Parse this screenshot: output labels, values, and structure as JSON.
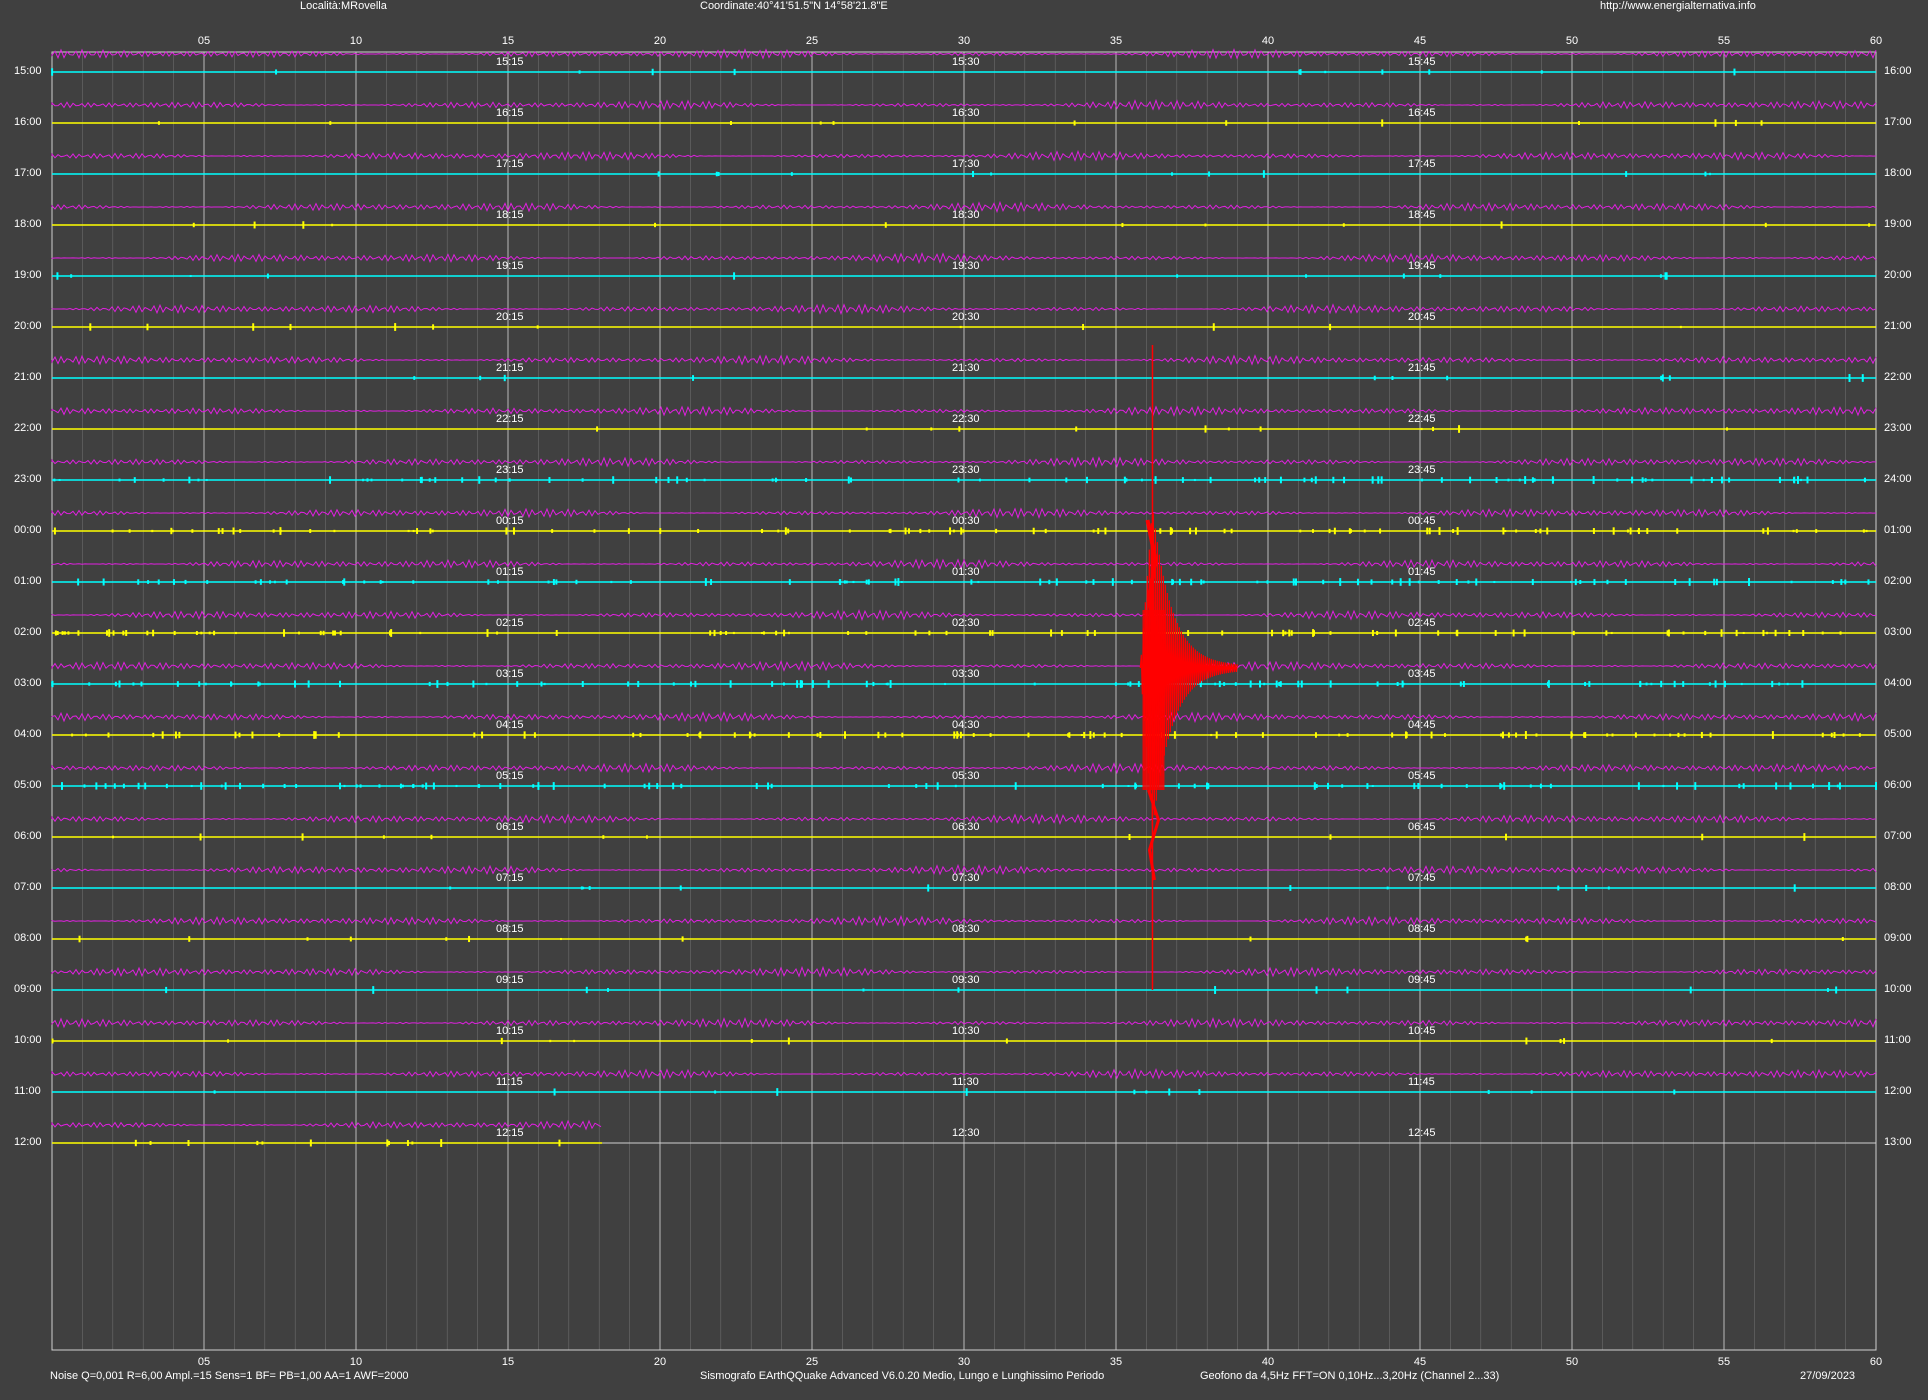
{
  "header": {
    "location": "Località:MRovella",
    "coordinates": "Coordinate:40°41'51.5\"N 14°58'21.8\"E",
    "url": "http://www.energialternativa.info"
  },
  "footer": {
    "settings": "Noise Q=0,001 R=6,00 Ampl.=15 Sens=1 BF= PB=1,00 AA=1 AWF=2000",
    "software": "Sismografo  EArthQQuake Advanced V6.0.20  Medio, Lungo e Lunghissimo Periodo",
    "sensor": "Geofono da 4,5Hz FFT=ON 0,10Hz...3,20Hz      (Channel 2...33)",
    "date": "27/09/2023"
  },
  "colors": {
    "background": "#404040",
    "grid_major": "#d0d0d0",
    "grid_minor": "#8a8a8a",
    "trace_yellow": "#ffff00",
    "trace_cyan": "#00ffff",
    "trace_magenta": "#e020e0",
    "event_red": "#ff0000",
    "text": "#ffffff"
  },
  "chart_data": {
    "type": "line",
    "minute_ticks": [
      "05",
      "10",
      "15",
      "20",
      "25",
      "30",
      "35",
      "40",
      "45",
      "50",
      "55",
      "60"
    ],
    "xlim": [
      0,
      60
    ],
    "row_labels_left": [
      "15:00",
      "16:00",
      "17:00",
      "18:00",
      "19:00",
      "20:00",
      "21:00",
      "22:00",
      "23:00",
      "00:00",
      "01:00",
      "02:00",
      "03:00",
      "04:00",
      "05:00",
      "06:00",
      "07:00",
      "08:00",
      "09:00",
      "10:00",
      "11:00",
      "12:00"
    ],
    "row_labels_right": [
      "16:00",
      "17:00",
      "18:00",
      "19:00",
      "20:00",
      "21:00",
      "22:00",
      "23:00",
      "24:00",
      "01:00",
      "02:00",
      "03:00",
      "04:00",
      "05:00",
      "06:00",
      "07:00",
      "08:00",
      "09:00",
      "10:00",
      "11:00",
      "12:00",
      "13:00"
    ],
    "quarter_labels": [
      [
        "15:15",
        "15:30",
        "15:45"
      ],
      [
        "16:15",
        "16:30",
        "16:45"
      ],
      [
        "17:15",
        "17:30",
        "17:45"
      ],
      [
        "18:15",
        "18:30",
        "18:45"
      ],
      [
        "19:15",
        "19:30",
        "19:45"
      ],
      [
        "20:15",
        "20:30",
        "20:45"
      ],
      [
        "21:15",
        "21:30",
        "21:45"
      ],
      [
        "22:15",
        "22:30",
        "22:45"
      ],
      [
        "23:15",
        "23:30",
        "23:45"
      ],
      [
        "00:15",
        "00:30",
        "00:45"
      ],
      [
        "01:15",
        "01:30",
        "01:45"
      ],
      [
        "02:15",
        "02:30",
        "02:45"
      ],
      [
        "03:15",
        "03:30",
        "03:45"
      ],
      [
        "04:15",
        "04:30",
        "04:45"
      ],
      [
        "05:15",
        "05:30",
        "05:45"
      ],
      [
        "06:15",
        "06:30",
        "06:45"
      ],
      [
        "07:15",
        "07:30",
        "07:45"
      ],
      [
        "08:15",
        "08:30",
        "08:45"
      ],
      [
        "09:15",
        "09:30",
        "09:45"
      ],
      [
        "10:15",
        "10:30",
        "10:45"
      ],
      [
        "11:15",
        "11:30",
        "11:45"
      ],
      [
        "12:15",
        "12:30",
        "12:45"
      ]
    ],
    "trace_colors": [
      "cyan",
      "yellow",
      "cyan",
      "yellow",
      "cyan",
      "yellow",
      "cyan",
      "yellow",
      "cyan",
      "yellow",
      "cyan",
      "yellow",
      "cyan",
      "yellow",
      "cyan",
      "yellow",
      "cyan",
      "yellow",
      "cyan",
      "yellow",
      "cyan",
      "yellow"
    ],
    "last_row_end_minute": 18.1,
    "event": {
      "hour_row": "02:00",
      "start_minute": 35.8,
      "peak_minute": 36.2,
      "end_minute": 39.0
    }
  }
}
